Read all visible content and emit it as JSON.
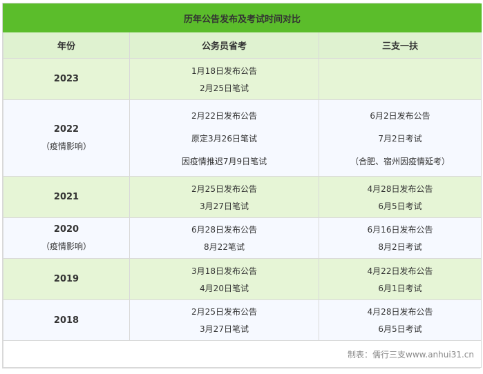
{
  "title": "历年公告发布及考试时间对比",
  "headers": [
    "年份",
    "公务员省考",
    "三支一扶"
  ],
  "rows": [
    {
      "year": "2023",
      "note": "",
      "civil": [
        "1月18日发布公告",
        "2月25日笔试"
      ],
      "sanzhi": []
    },
    {
      "year": "2022",
      "note": "（疫情影响）",
      "civil": [
        "2月22日发布公告",
        "原定3月26日笔试",
        "因疫情推迟7月9日笔试"
      ],
      "sanzhi": [
        "6月2日发布公告",
        "7月2日考试",
        "（合肥、宿州因疫情延考）"
      ]
    },
    {
      "year": "2021",
      "note": "",
      "civil": [
        "2月25日发布公告",
        "3月27日笔试"
      ],
      "sanzhi": [
        "4月28日发布公告",
        "6月5日考试"
      ]
    },
    {
      "year": "2020",
      "note": "（疫情影响）",
      "civil": [
        "6月28日发布公告",
        "8月22笔试"
      ],
      "sanzhi": [
        "6月16日发布公告",
        "8月2日考试"
      ]
    },
    {
      "year": "2019",
      "note": "",
      "civil": [
        "3月18日发布公告",
        "4月20日笔试"
      ],
      "sanzhi": [
        "4月22日发布公告",
        "6月1日考试"
      ]
    },
    {
      "year": "2018",
      "note": "",
      "civil": [
        "2月25日发布公告",
        "3月27日笔试"
      ],
      "sanzhi": [
        "4月28日发布公告",
        "6月5日考试"
      ]
    }
  ],
  "footer": "制表：儒行三支www.anhui31.cn"
}
